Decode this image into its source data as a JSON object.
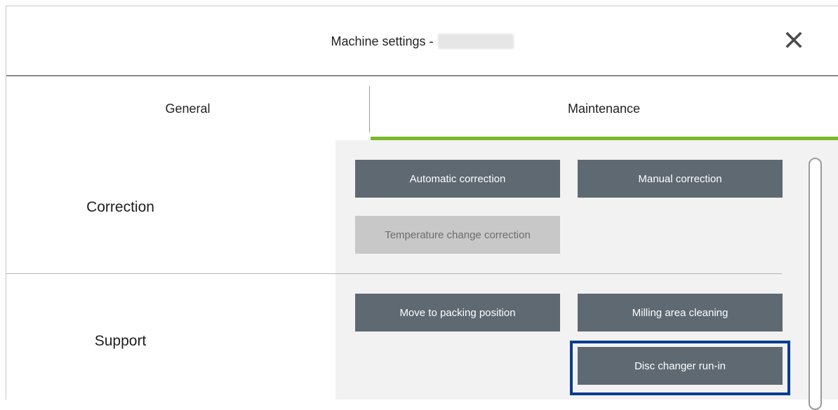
{
  "header": {
    "title": "Machine settings -",
    "title_suffix_redacted": true,
    "close_icon": "close-icon"
  },
  "tabs": [
    {
      "label": "General",
      "active": false
    },
    {
      "label": "Maintenance",
      "active": true
    }
  ],
  "sections": {
    "correction": {
      "label": "Correction",
      "buttons": [
        {
          "label": "Automatic correction",
          "enabled": true
        },
        {
          "label": "Manual correction",
          "enabled": true
        },
        {
          "label": "Temperature change correction",
          "enabled": false
        }
      ]
    },
    "support": {
      "label": "Support",
      "buttons": [
        {
          "label": "Move to packing position",
          "enabled": true
        },
        {
          "label": "Milling area cleaning",
          "enabled": true
        },
        {
          "label": "Disc changer run-in",
          "enabled": true,
          "focused": true
        }
      ]
    }
  },
  "colors": {
    "accent_underline": "#7ab929",
    "button_bg": "#5e6972",
    "button_disabled_bg": "#c8c8c8",
    "focus_ring": "#0a3d8f",
    "content_bg": "#f2f2f2"
  }
}
